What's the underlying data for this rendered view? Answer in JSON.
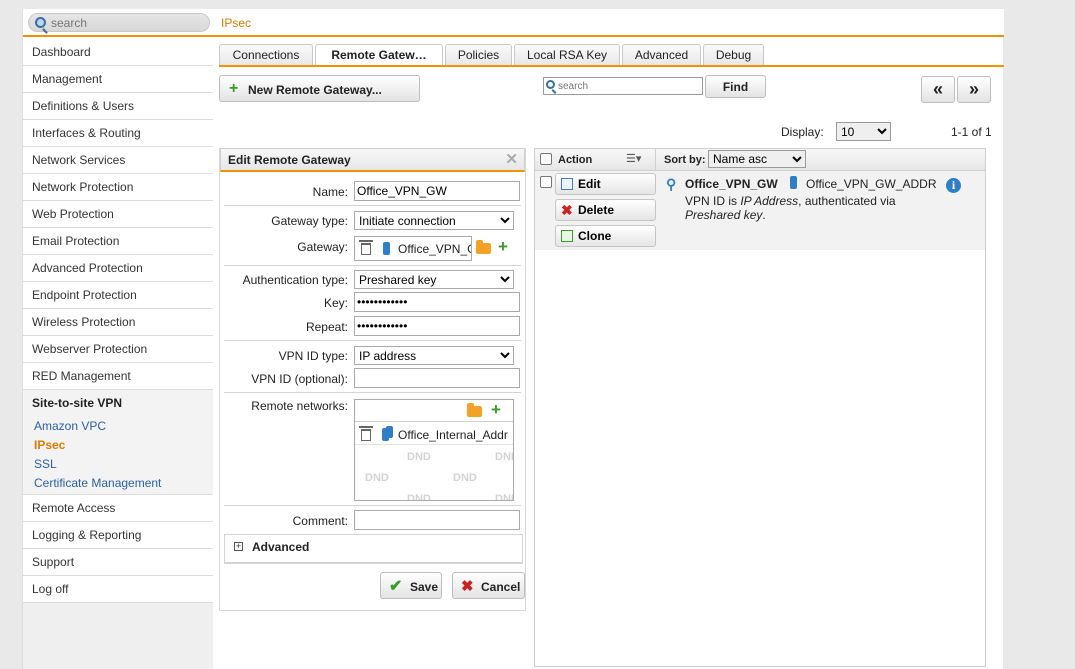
{
  "topbar": {
    "search_placeholder": "search",
    "breadcrumb": "IPsec"
  },
  "sidebar": {
    "items_top": [
      "Dashboard",
      "Management",
      "Definitions & Users",
      "Interfaces & Routing",
      "Network Services",
      "Network Protection",
      "Web Protection",
      "Email Protection",
      "Advanced Protection",
      "Endpoint Protection",
      "Wireless Protection",
      "Webserver Protection",
      "RED Management"
    ],
    "section": "Site-to-site VPN",
    "sub_items": [
      "Amazon VPC",
      "IPsec",
      "SSL",
      "Certificate Management"
    ],
    "active_sub": "IPsec",
    "items_bottom": [
      "Remote Access",
      "Logging & Reporting",
      "Support",
      "Log off"
    ]
  },
  "tabs": [
    {
      "label": "Connections"
    },
    {
      "label": "Remote Gatew…"
    },
    {
      "label": "Policies"
    },
    {
      "label": "Local RSA Key"
    },
    {
      "label": "Advanced"
    },
    {
      "label": "Debug"
    }
  ],
  "active_tab": "Remote Gatew…",
  "toolbar": {
    "new_button": "New Remote Gateway...",
    "search_placeholder": "search",
    "find_button": "Find",
    "prev_glyph": "«",
    "next_glyph": "»",
    "display_label": "Display:",
    "display_value": "10",
    "page_info": "1-1 of 1"
  },
  "edit": {
    "title": "Edit Remote Gateway",
    "close_glyph": "✕",
    "name_label": "Name:",
    "name_value": "Office_VPN_GW",
    "gateway_type_label": "Gateway type:",
    "gateway_type_value": "Initiate connection",
    "gateway_label": "Gateway:",
    "gateway_value": "Office_VPN_GW_ADDR",
    "auth_type_label": "Authentication type:",
    "auth_type_value": "Preshared key",
    "key_label": "Key:",
    "key_value": "••••••••••••",
    "repeat_label": "Repeat:",
    "repeat_value": "••••••••••••",
    "vpn_id_type_label": "VPN ID type:",
    "vpn_id_type_value": "IP address",
    "vpn_id_label": "VPN ID (optional):",
    "vpn_id_value": "",
    "remote_networks_label": "Remote networks:",
    "remote_network_item": "Office_Internal_Addr",
    "dnd_text": "DND",
    "comment_label": "Comment:",
    "comment_value": "",
    "advanced_label": "Advanced",
    "advanced_toggle": "+",
    "save_button": "Save",
    "cancel_button": "Cancel"
  },
  "list": {
    "action_header": "Action",
    "sort_label": "Sort by:",
    "sort_value": "Name asc",
    "rows": [
      {
        "name": "Office_VPN_GW",
        "gateway": "Office_VPN_GW_ADDR",
        "desc_prefix": "VPN ID is ",
        "desc_id": "IP Address",
        "desc_mid": ", authenticated via",
        "desc_auth": "Preshared key",
        "desc_end": ".",
        "edit": "Edit",
        "delete": "Delete",
        "clone": "Clone"
      }
    ]
  },
  "colors": {
    "accent": "#f39200",
    "link": "#2a5fa5",
    "active": "#e07b00"
  }
}
